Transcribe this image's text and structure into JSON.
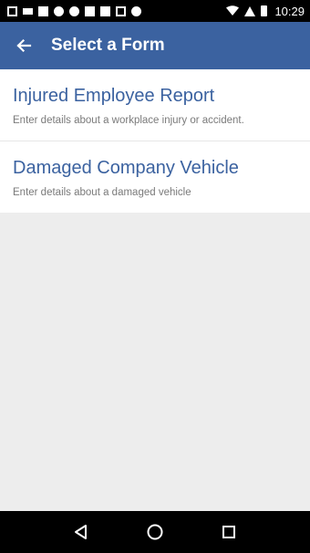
{
  "status_bar": {
    "time": "10:29",
    "icons": [
      "image-icon",
      "voicemail-icon",
      "flag-icon",
      "pinwheel-icon",
      "pinwheel-icon",
      "flag-icon",
      "flag-icon",
      "photo-icon",
      "circle-icon",
      "wifi-icon",
      "signal-icon",
      "battery-icon"
    ]
  },
  "app_bar": {
    "title": "Select a Form",
    "back_icon": "arrow-left-icon",
    "background": "#3b62a0"
  },
  "forms": [
    {
      "title": "Injured Employee Report",
      "description": "Enter details about a workplace injury or accident."
    },
    {
      "title": "Damaged Company Vehicle",
      "description": "Enter details about a damaged vehicle"
    }
  ],
  "nav_bar": {
    "icons": [
      "back-triangle-icon",
      "home-circle-icon",
      "recents-square-icon"
    ]
  },
  "colors": {
    "accent": "#3b62a0",
    "background": "#ededed",
    "description_text": "#7a7a7a"
  }
}
